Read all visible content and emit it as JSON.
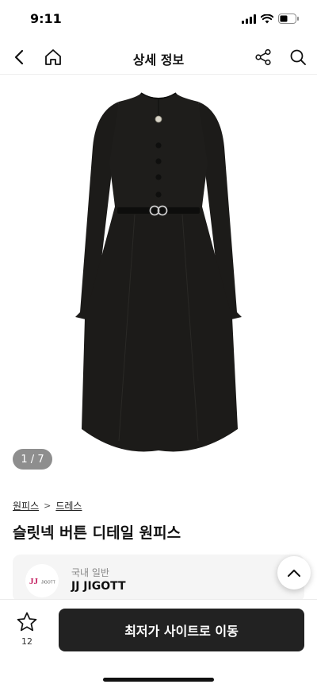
{
  "status_bar": {
    "time": "9:11"
  },
  "nav": {
    "title": "상세 정보"
  },
  "gallery": {
    "indicator": "1 / 7"
  },
  "breadcrumb": {
    "level1": "원피스",
    "separator": ">",
    "level2": "드레스"
  },
  "product": {
    "title": "슬릿넥 버튼 디테일 원피스"
  },
  "brand": {
    "category": "국내 일반",
    "name": "JJ JIGOTT",
    "logo_text": "JJ",
    "logo_subtext": "JIGOTT"
  },
  "bottom_bar": {
    "favorite_count": "12",
    "cta_label": "최저가 사이트로 이동"
  },
  "colors": {
    "cta_background": "#222222",
    "dress": "#1c1b19",
    "logo_accent": "#c2185b"
  }
}
